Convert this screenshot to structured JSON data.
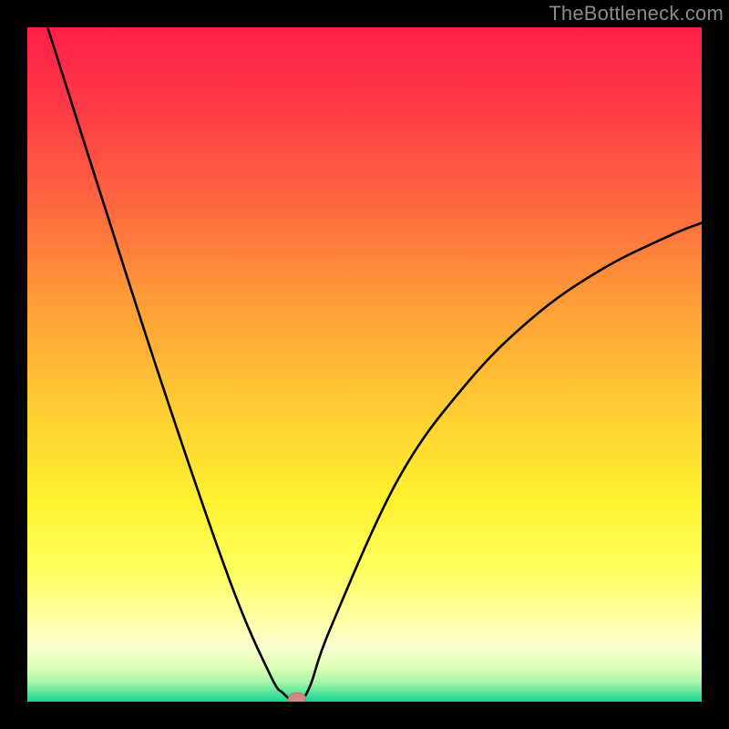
{
  "watermark": "TheBottleneck.com",
  "chart_data": {
    "type": "line",
    "title": "",
    "xlabel": "",
    "ylabel": "",
    "xlim": [
      0,
      100
    ],
    "ylim": [
      0,
      100
    ],
    "series": [
      {
        "name": "curve",
        "x": [
          3,
          10,
          20,
          30,
          36,
          38,
          39.5,
          40.5,
          42,
          45,
          55,
          65,
          75,
          85,
          95,
          100
        ],
        "y": [
          100,
          78,
          47,
          18,
          4,
          1.2,
          0.1,
          0.1,
          2.5,
          11,
          33,
          47,
          57,
          64,
          69,
          71
        ]
      }
    ],
    "marker": {
      "x": 40,
      "y": 0,
      "color": "#cf8a7f"
    },
    "gradient_stops": [
      {
        "pos": 0,
        "color": "#ff1f49"
      },
      {
        "pos": 0.12,
        "color": "#ff3a46"
      },
      {
        "pos": 0.27,
        "color": "#ff6a3f"
      },
      {
        "pos": 0.4,
        "color": "#ff9a38"
      },
      {
        "pos": 0.55,
        "color": "#ffc833"
      },
      {
        "pos": 0.7,
        "color": "#fff12f"
      },
      {
        "pos": 0.8,
        "color": "#ffff5a"
      },
      {
        "pos": 0.88,
        "color": "#ffffa8"
      },
      {
        "pos": 0.92,
        "color": "#fbffd0"
      },
      {
        "pos": 0.95,
        "color": "#dcffb4"
      },
      {
        "pos": 0.97,
        "color": "#a9f7a9"
      },
      {
        "pos": 0.985,
        "color": "#5fe69b"
      },
      {
        "pos": 1.0,
        "color": "#18d396"
      }
    ]
  }
}
